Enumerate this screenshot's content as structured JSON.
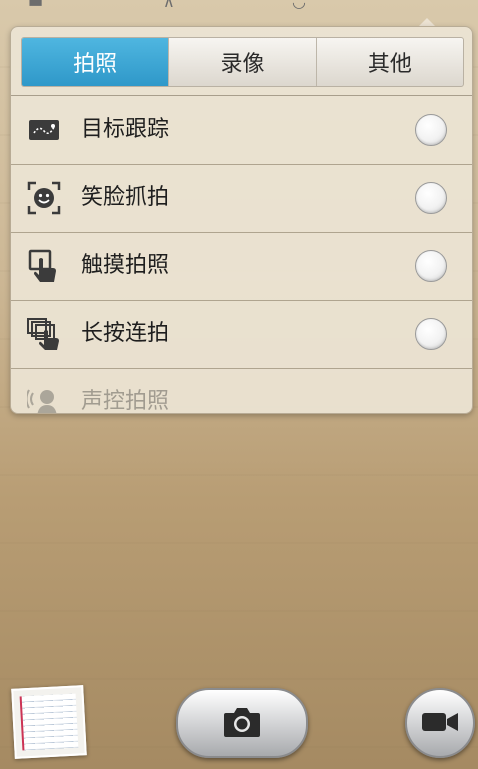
{
  "tabs": [
    {
      "label": "拍照",
      "active": true
    },
    {
      "label": "录像",
      "active": false
    },
    {
      "label": "其他",
      "active": false
    }
  ],
  "options": [
    {
      "label": "目标跟踪",
      "icon": "target-tracking-icon",
      "selected": false
    },
    {
      "label": "笑脸抓拍",
      "icon": "smile-face-icon",
      "selected": false
    },
    {
      "label": "触摸拍照",
      "icon": "touch-shoot-icon",
      "selected": false
    },
    {
      "label": "长按连拍",
      "icon": "burst-shoot-icon",
      "selected": false
    },
    {
      "label": "声控拍照",
      "icon": "voice-control-icon",
      "selected": false
    }
  ],
  "bottom": {
    "thumbnail": "gallery-thumbnail",
    "shutter_icon": "camera-icon",
    "video_icon": "video-camera-icon"
  },
  "colors": {
    "tab_active": "#3aa7d6",
    "panel_bg": "#ece4d4",
    "background": "#cdb896"
  }
}
